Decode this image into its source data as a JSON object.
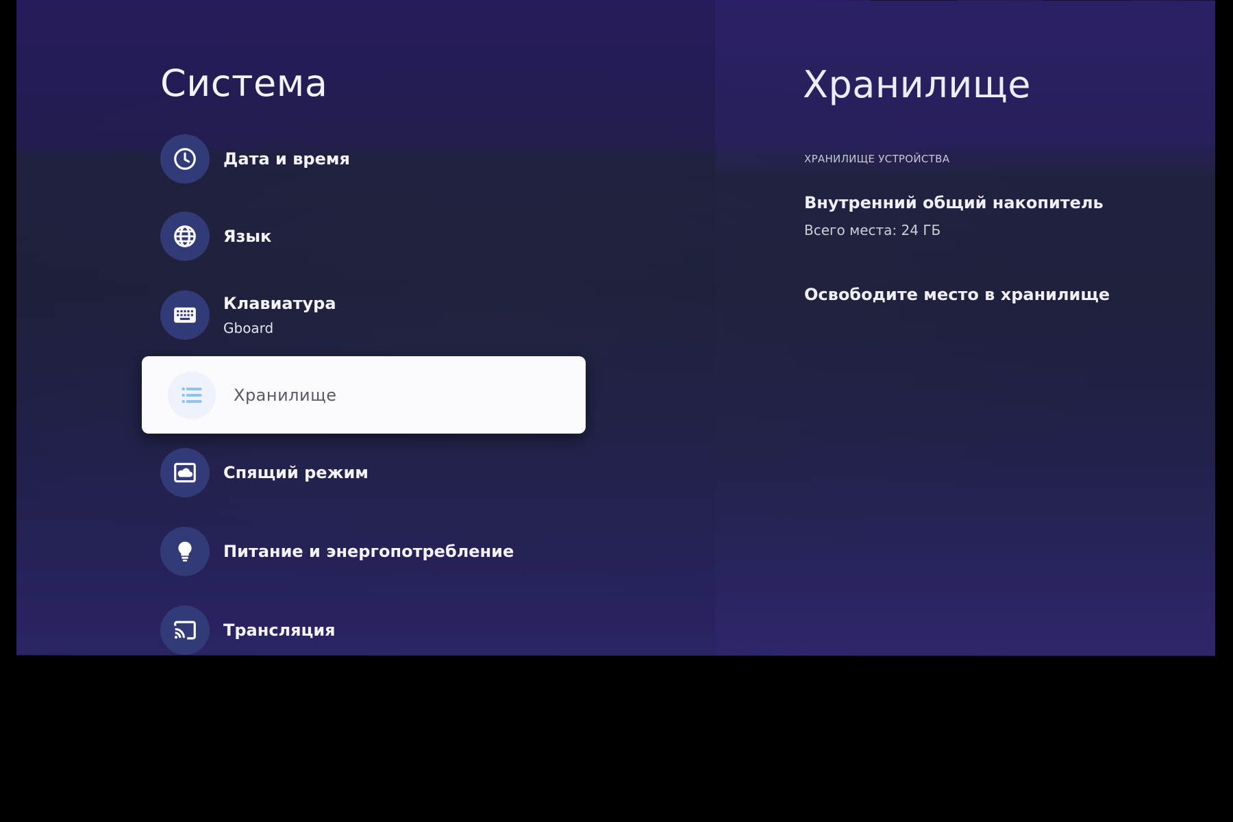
{
  "left_panel": {
    "title": "Система",
    "items": [
      {
        "label": "Дата и время",
        "sublabel": "",
        "icon": "clock-icon"
      },
      {
        "label": "Язык",
        "sublabel": "",
        "icon": "globe-icon"
      },
      {
        "label": "Клавиатура",
        "sublabel": "Gboard",
        "icon": "keyboard-icon"
      },
      {
        "label": "Хранилище",
        "sublabel": "",
        "icon": "storage-list-icon",
        "selected": true
      },
      {
        "label": "Спящий режим",
        "sublabel": "",
        "icon": "screensaver-icon"
      },
      {
        "label": "Питание и энергопотребление",
        "sublabel": "",
        "icon": "lightbulb-icon"
      },
      {
        "label": "Трансляция",
        "sublabel": "",
        "icon": "cast-icon"
      }
    ]
  },
  "right_panel": {
    "title": "Хранилище",
    "section_header": "ХРАНИЛИЩЕ УСТРОЙСТВА",
    "storage_item": {
      "title": "Внутренний общий накопитель",
      "subtitle": "Всего места: 24 ГБ"
    },
    "action": "Освободите место в хранилище"
  },
  "colors": {
    "background": "#22204a",
    "icon_circle": "#333a78",
    "selected_card": "#fbfbfd",
    "selected_icon": "#8fc1ef",
    "text": "#f4f4f8"
  }
}
